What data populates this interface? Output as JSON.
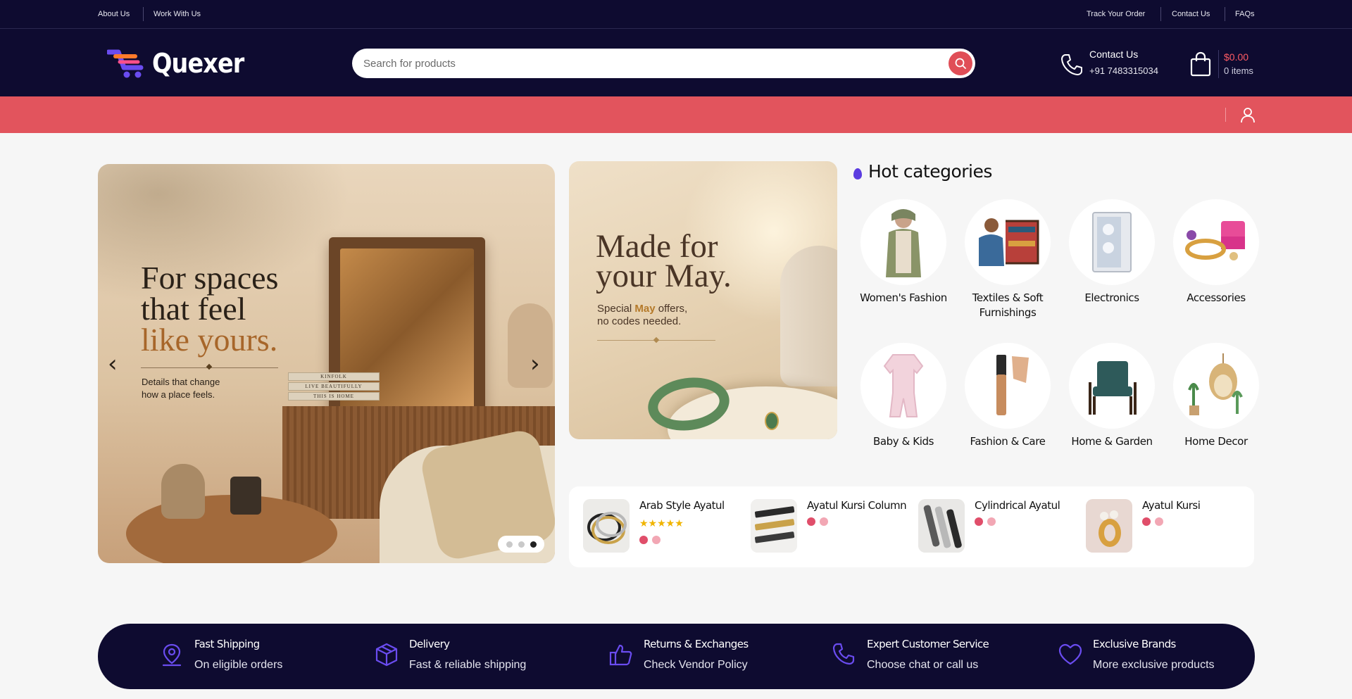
{
  "topbar": {
    "left_links": [
      "About Us",
      "Work With Us"
    ],
    "right_links": [
      "Track Your Order",
      "Contact Us",
      "FAQs"
    ]
  },
  "header": {
    "logo_text": "Quexer",
    "search_placeholder": "Search for products",
    "contact_label": "Contact Us",
    "contact_phone": "+91 7483315034",
    "cart_total": "$0.00",
    "cart_items": "0 items"
  },
  "hero": {
    "line1": "For spaces",
    "line2": "that feel",
    "line3": "like yours.",
    "subtitle": "Details that change\nhow a place feels.",
    "books": [
      "KINFOLK",
      "LIVE BEAUTIFULLY",
      "THIS IS HOME"
    ],
    "prev_arrow": "‹",
    "next_arrow": "›",
    "slide_count": 3,
    "active_slide": 3
  },
  "promo": {
    "title_line1": "Made for",
    "title_line2": "your May.",
    "sub_prefix": "Special ",
    "sub_highlight": "May",
    "sub_suffix": " offers,",
    "sub_line2": "no codes needed."
  },
  "hot_categories": {
    "title": "Hot categories",
    "items": [
      {
        "name": "Women's Fashion",
        "icon": "woman-fashion-icon"
      },
      {
        "name": "Textiles & Soft Furnishings",
        "icon": "textile-weaver-icon"
      },
      {
        "name": "Electronics",
        "icon": "pc-case-icon"
      },
      {
        "name": "Accessories",
        "icon": "jewelry-box-icon"
      },
      {
        "name": "Baby & Kids",
        "icon": "baby-onesie-icon"
      },
      {
        "name": "Fashion & Care",
        "icon": "cosmetic-tube-icon"
      },
      {
        "name": "Home & Garden",
        "icon": "armchair-icon"
      },
      {
        "name": "Home Decor",
        "icon": "hanging-chair-icon"
      }
    ]
  },
  "products": [
    {
      "name": "Arab Style Ayatul",
      "rating": 5,
      "swatches": [
        "#e04e6a",
        "#f2a7b4"
      ]
    },
    {
      "name": "Ayatul Kursi Column",
      "rating": null,
      "swatches": [
        "#e04e6a",
        "#f2a7b4"
      ]
    },
    {
      "name": "Cylindrical Ayatul",
      "rating": null,
      "swatches": [
        "#e04e6a",
        "#f2a7b4"
      ]
    },
    {
      "name": "Ayatul Kursi",
      "rating": null,
      "swatches": [
        "#e04e6a",
        "#f2a7b4"
      ]
    }
  ],
  "features": [
    {
      "title": "Fast Shipping",
      "subtitle": "On eligible orders",
      "icon": "map-pin-icon"
    },
    {
      "title": "Delivery",
      "subtitle": "Fast & reliable shipping",
      "icon": "box-icon"
    },
    {
      "title": "Returns & Exchanges",
      "subtitle": "Check Vendor Policy",
      "icon": "thumbs-up-icon"
    },
    {
      "title": "Expert Customer Service",
      "subtitle": "Choose chat or call us",
      "icon": "phone-icon"
    },
    {
      "title": "Exclusive Brands",
      "subtitle": "More exclusive products",
      "icon": "heart-icon"
    }
  ],
  "colors": {
    "navy": "#0e0b30",
    "accent_red": "#e2545d",
    "icon_purple": "#6a4cf0",
    "price_red": "#ff5b64"
  }
}
